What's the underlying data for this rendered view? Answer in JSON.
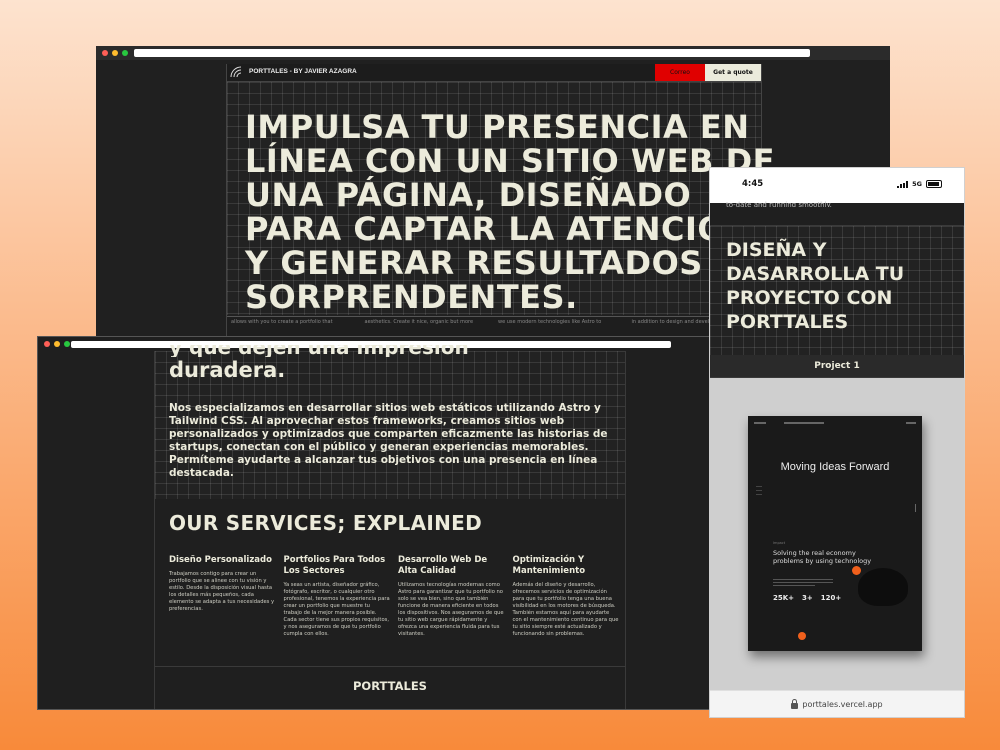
{
  "back_window": {
    "nav": {
      "brand": "PORTTALES - BY JAVIER AZAGRA",
      "cta_primary": "Correo",
      "cta_quote": "Get a quote"
    },
    "hero_title": "IMPULSA TU PRESENCIA EN\nLÍNEA CON UN SITIO WEB DE\nUNA PÁGINA, DISEÑADO\nPARA CAPTAR LA ATENCIÓN\nY GENERAR RESULTADOS\nSORPRENDENTES.",
    "bottom_strip": [
      "allows with you to create a portfolio that",
      "aesthetics. Create it nice, organic but more",
      "we use modern technologies like Astro to",
      "in addition to design and develop"
    ]
  },
  "front_window": {
    "hero_cut_line": "y que dejen una impresión",
    "hero_end": "duradera.",
    "paragraph": "Nos especializamos en desarrollar sitios web estáticos utilizando Astro y Tailwind CSS. Al aprovechar estos frameworks, creamos sitios web personalizados y optimizados que comparten eficazmente las historias de startups, conectan con el público y generan experiencias memorables. Permíteme ayudarte a alcanzar tus objetivos con una presencia en línea destacada.",
    "services_title": "OUR SERVICES; EXPLAINED",
    "services": [
      {
        "title": "Diseño Personalizado",
        "text": "Trabajamos contigo para crear un portfolio que se alinee con tu visión y estilo. Desde la disposición visual hasta los detalles más pequeños, cada elemento se adapta a tus necesidades y preferencias."
      },
      {
        "title": "Portfolios Para Todos Los Sectores",
        "text": "Ya seas un artista, diseñador gráfico, fotógrafo, escritor, o cualquier otro profesional, tenemos la experiencia para crear un portfolio que muestre tu trabajo de la mejor manera posible. Cada sector tiene sus propios requisitos, y nos aseguramos de que tu portfolio cumpla con ellos."
      },
      {
        "title": "Desarrollo Web De Alta Calidad",
        "text": "Utilizamos tecnologías modernas como Astro para garantizar que tu portfolio no solo se vea bien, sino que también funcione de manera eficiente en todos los dispositivos. Nos aseguramos de que tu sitio web cargue rápidamente y ofrezca una experiencia fluida para tus visitantes."
      },
      {
        "title": "Optimización Y Mantenimiento",
        "text": "Además del diseño y desarrollo, ofrecemos servicios de optimización para que tu portfolio tenga una buena visibilidad en los motores de búsqueda. También estamos aquí para ayudarte con el mantenimiento continuo para que tu sitio siempre esté actualizado y funcionando sin problemas."
      }
    ],
    "footer_brand": "PORTTALES"
  },
  "phone": {
    "time": "4:45",
    "network": "5G",
    "cut_line": "to-date and running smoothly.",
    "hero_title": "DISEÑA Y\nDASARROLLA TU\nPROYECTO CON\nPORTTALES",
    "project_label": "Project 1",
    "mockup": {
      "headline": "Moving Ideas Forward",
      "section_label": "Impact",
      "subhead": "Solving the real economy problems by using technology",
      "stats": [
        "25K+",
        "3+",
        "120+"
      ]
    },
    "url": "porttales.vercel.app"
  },
  "colors": {
    "accent_red": "#e00000",
    "cream": "#ecebdb",
    "orange_accent": "#f0601c"
  }
}
